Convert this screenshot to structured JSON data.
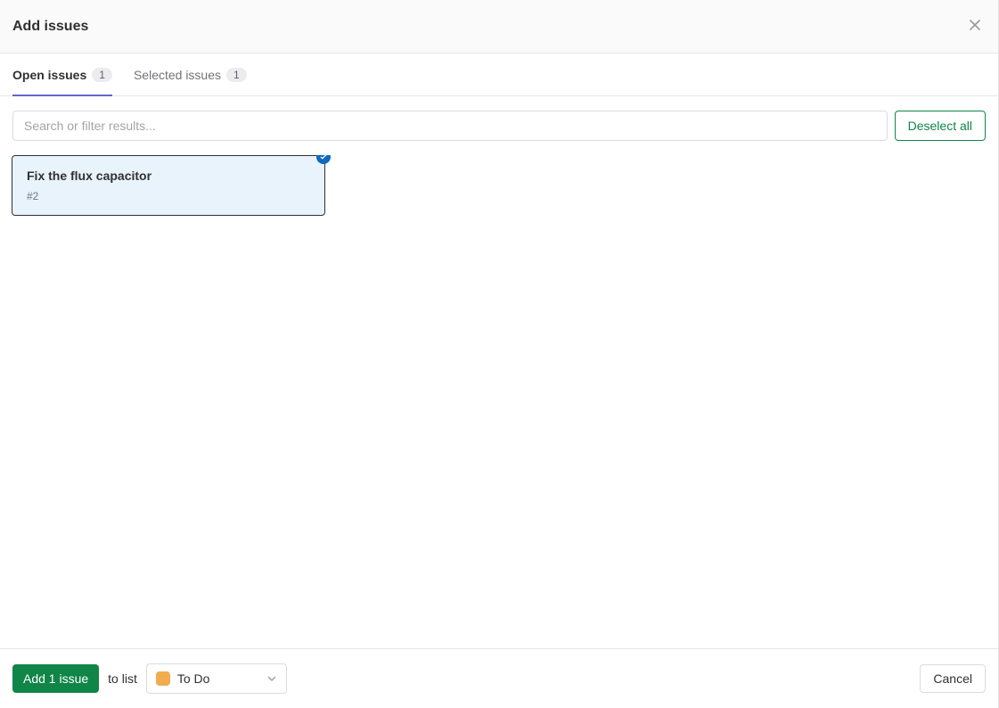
{
  "header": {
    "title": "Add issues"
  },
  "tabs": {
    "open": {
      "label": "Open issues",
      "count": "1"
    },
    "selected": {
      "label": "Selected issues",
      "count": "1"
    }
  },
  "search": {
    "placeholder": "Search or filter results..."
  },
  "actions": {
    "deselect": "Deselect all"
  },
  "issues": [
    {
      "title": "Fix the flux capacitor",
      "ref": "#2"
    }
  ],
  "footer": {
    "add_label": "Add 1 issue",
    "to_list_label": "to list",
    "selected_list": "To Do",
    "selected_list_color": "#f0ad4e",
    "cancel_label": "Cancel"
  }
}
